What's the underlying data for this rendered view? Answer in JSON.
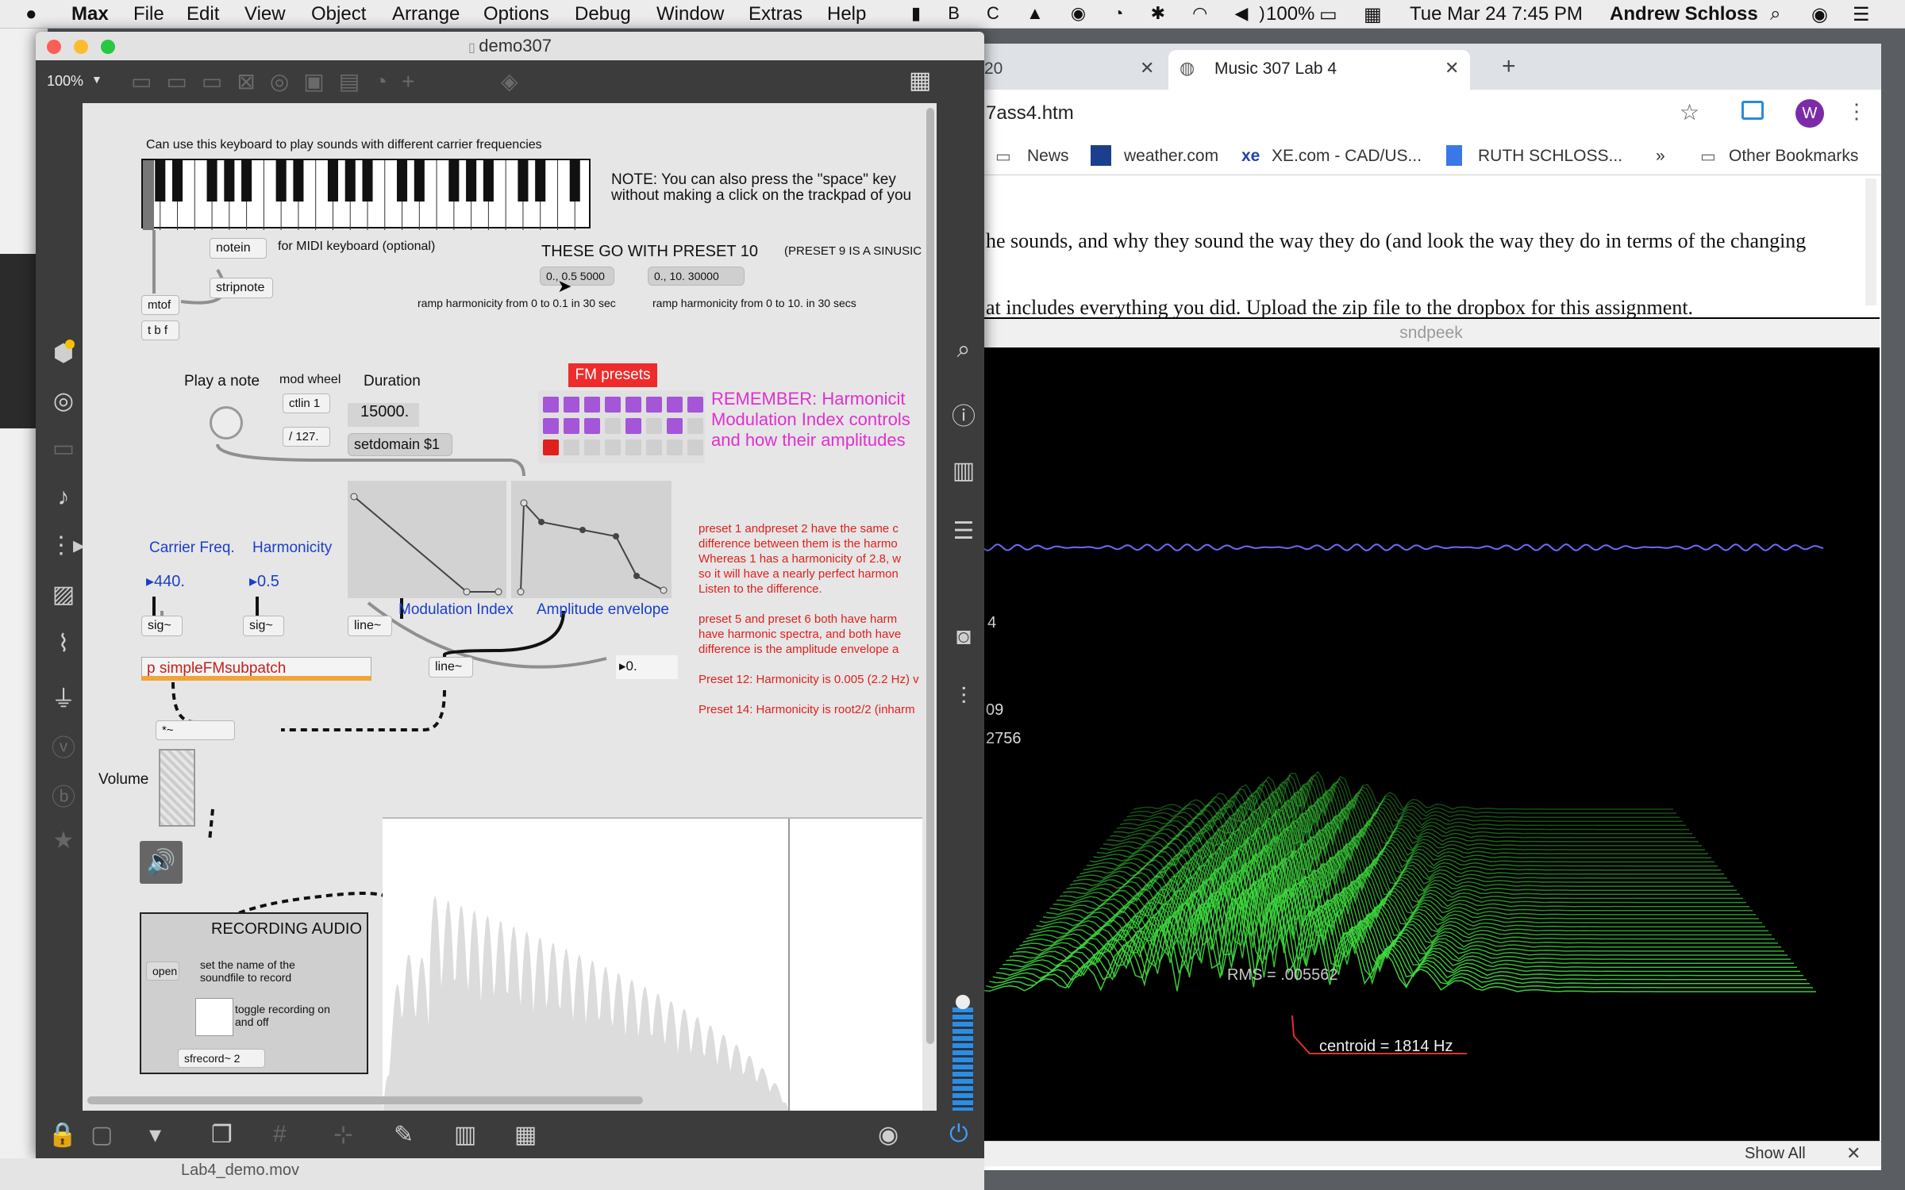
{
  "menubar": {
    "app": "Max",
    "items": [
      "File",
      "Edit",
      "View",
      "Object",
      "Arrange",
      "Options",
      "Debug",
      "Window",
      "Extras",
      "Help"
    ],
    "battery": "100%",
    "clock": "Tue Mar 24  7:45 PM",
    "user": "Andrew Schloss"
  },
  "max": {
    "window_title": "demo307",
    "zoom": "100%",
    "keyboard_caption": "Can use this keyboard to play sounds with different carrier frequencies",
    "note_line1": "NOTE:  You can also  press the \"space\" key",
    "note_line2": "without making a click on the trackpad of you",
    "notein": "notein",
    "midi_caption": "for MIDI keyboard (optional)",
    "stripnote": "stripnote",
    "mtof": "mtof",
    "tbf": "t b f",
    "preset10_heading": "THESE GO WITH PRESET 10",
    "preset9_note": "(PRESET 9 IS A SINUSIC",
    "msg1": "0., 0.5 5000",
    "msg2": "0., 10. 30000",
    "ramp1": "ramp harmonicity from  0 to 0.1 in 30 sec",
    "ramp2": "ramp harmonicity from  0 to 10. in 30 secs",
    "play_note": "Play a note",
    "mod_wheel": "mod wheel",
    "ctlin": "ctlin 1",
    "div127": "/ 127.",
    "duration_label": "Duration",
    "duration_value": "15000.",
    "setdomain": "setdomain $1",
    "fm_presets": "FM presets",
    "remember1": "REMEMBER: Harmonicit",
    "remember2": "Modulation Index controls",
    "remember3": "and how their amplitudes",
    "carrier_label": "Carrier Freq.",
    "harmonicity_label": "Harmonicity",
    "carrier_value": "440.",
    "harmonicity_value": "0.5",
    "sig1": "sig~",
    "sig2": "sig~",
    "line1": "line~",
    "line2": "line~",
    "mod_index": "Modulation Index",
    "amp_env": "Amplitude envelope",
    "float_out": "0.",
    "subpatch": "p simpleFMsubpatch",
    "mult": "*~",
    "volume": "Volume",
    "recording_title": "RECORDING AUDIO",
    "open_btn": "open",
    "open_desc1": "set the name of the",
    "open_desc2": "soundfile to record",
    "toggle_desc1": "toggle recording on",
    "toggle_desc2": "and off",
    "sfrecord": "sfrecord~ 2",
    "notes": [
      "preset 1 andpreset 2 have the same c",
      "difference between them  is the harmo",
      "Whereas 1 has a harmonicity of 2.8, w",
      "so it will have a nearly perfect harmon",
      "Listen to the difference.",
      "",
      "preset 5 and preset 6 both have harm",
      "have harmonic spectra, and both have",
      "difference is the amplitude envelope a",
      "",
      "Preset 12:  Harmonicity is 0.005 (2.2 Hz) v",
      "",
      "Preset 14:  Harmonicity is root2/2  (inharm"
    ]
  },
  "chrome": {
    "tab_left_fragment": "20",
    "tab_active": "Music 307 Lab 4",
    "url_fragment": "7ass4.htm",
    "avatar": "W",
    "bookmarks": [
      "News",
      "weather.com",
      "XE.com - CAD/US...",
      "RUTH SCHLOSS...",
      "Other Bookmarks"
    ],
    "more": "»",
    "page_line1": "he sounds, and why they sound the way they do (and look the way they do in terms of the changing",
    "page_line2": "at includes everything you did. Upload the zip file to the dropbox for this assignment."
  },
  "sndpeek": {
    "title": "sndpeek",
    "readouts": [
      "4",
      "09",
      "2756"
    ],
    "rms": "RMS = .005562",
    "centroid": "centroid  =  1814  Hz"
  },
  "dock": {
    "file": "Lab4_demo.mov",
    "show_all": "Show All"
  },
  "colors": {
    "accent_red": "#e0201c",
    "number_blue": "#1a3ec8",
    "magenta": "#e030d0",
    "preset_purple": "#a555d8",
    "spectrum_green": "#3fd83f",
    "waveform_blue": "#6b6bff"
  }
}
